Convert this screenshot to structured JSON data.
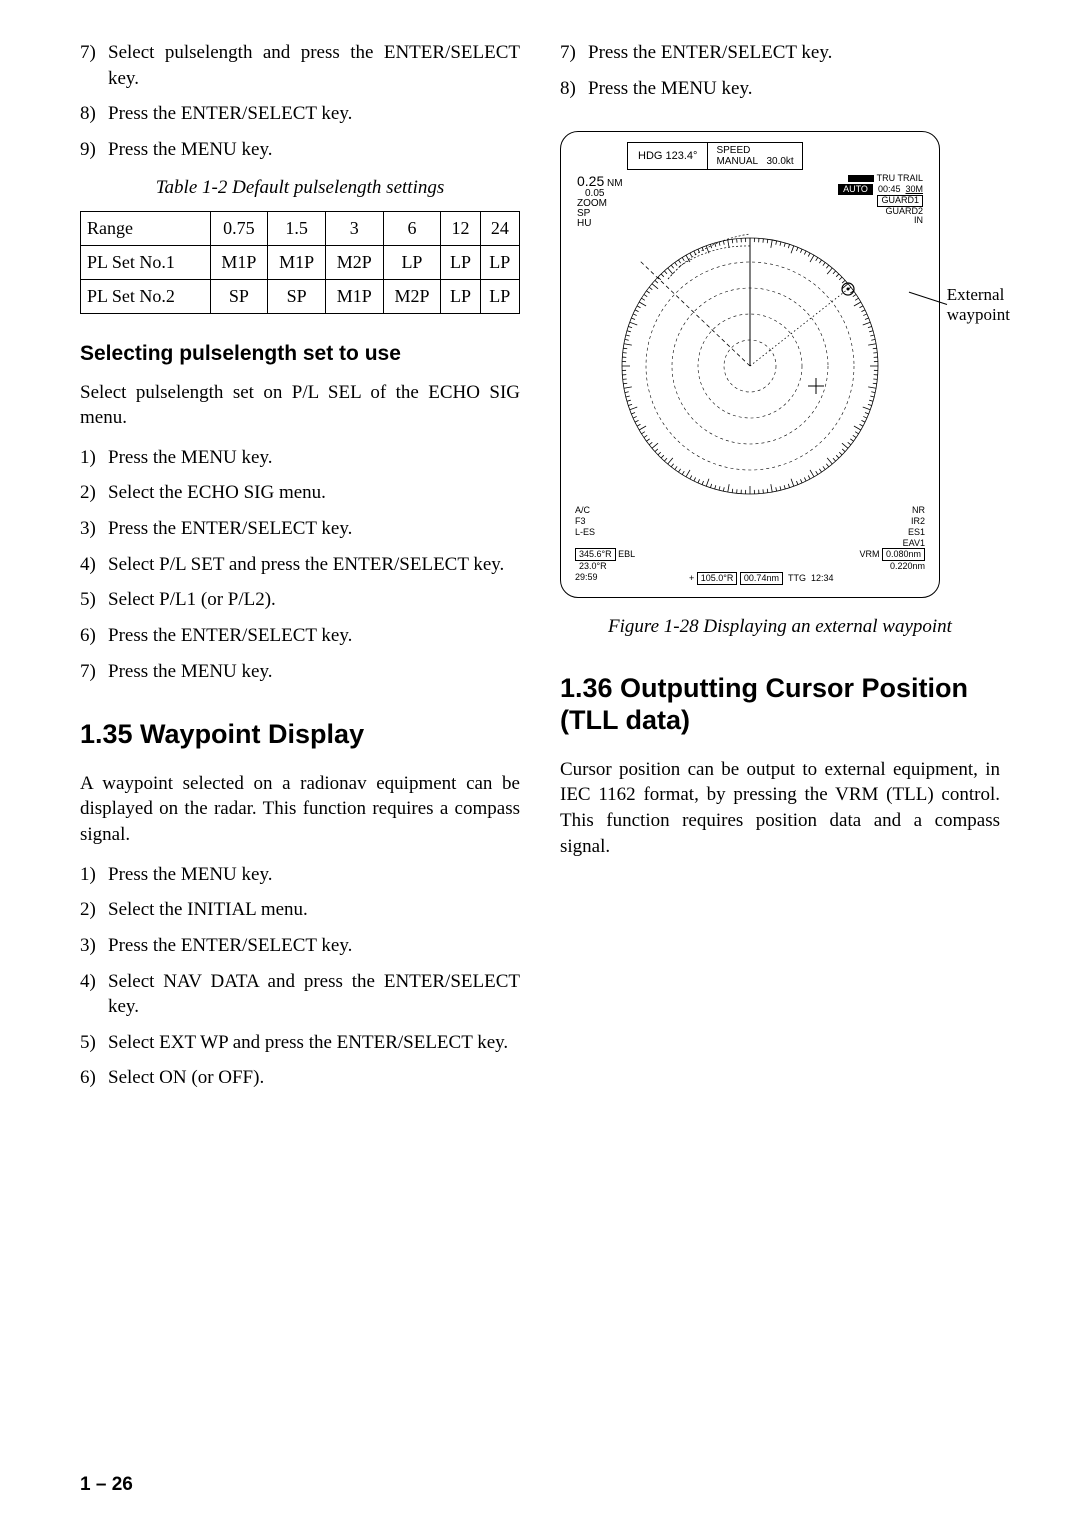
{
  "left": {
    "steps1": [
      {
        "n": "7)",
        "t": "Select pulselength and press the ENTER/SELECT key."
      },
      {
        "n": "8)",
        "t": "Press the ENTER/SELECT key."
      },
      {
        "n": "9)",
        "t": "Press the MENU key."
      }
    ],
    "table_caption": "Table 1-2 Default pulselength settings",
    "table": {
      "header": [
        "Range",
        "0.75",
        "1.5",
        "3",
        "6",
        "12",
        "24"
      ],
      "rows": [
        [
          "PL Set No.1",
          "M1P",
          "M1P",
          "M2P",
          "LP",
          "LP",
          "LP"
        ],
        [
          "PL Set No.2",
          "SP",
          "SP",
          "M1P",
          "M2P",
          "LP",
          "LP"
        ]
      ]
    },
    "subhead": "Selecting pulselength set to use",
    "para1": "Select pulselength set on P/L SEL of the ECHO SIG menu.",
    "steps2": [
      {
        "n": "1)",
        "t": "Press the MENU key."
      },
      {
        "n": "2)",
        "t": "Select the ECHO SIG menu."
      },
      {
        "n": "3)",
        "t": "Press the ENTER/SELECT key."
      },
      {
        "n": "4)",
        "t": "Select P/L SET and press the ENTER/SELECT key."
      },
      {
        "n": "5)",
        "t": "Select P/L1 (or P/L2)."
      },
      {
        "n": "6)",
        "t": "Press the ENTER/SELECT key."
      },
      {
        "n": "7)",
        "t": "Press the MENU key."
      }
    ],
    "section_head": "1.35 Waypoint Display",
    "para2": "A waypoint selected on a radionav equipment can be displayed on the radar. This function requires a compass signal.",
    "steps3": [
      {
        "n": "1)",
        "t": "Press the MENU key."
      },
      {
        "n": "2)",
        "t": "Select the INITIAL menu."
      },
      {
        "n": "3)",
        "t": "Press the ENTER/SELECT key."
      },
      {
        "n": "4)",
        "t": "Select NAV DATA and press the ENTER/SELECT key."
      },
      {
        "n": "5)",
        "t": "Select EXT WP and press the ENTER/SELECT key."
      },
      {
        "n": "6)",
        "t": "Select ON (or OFF)."
      }
    ]
  },
  "right": {
    "steps1": [
      {
        "n": "7)",
        "t": "Press the ENTER/SELECT key."
      },
      {
        "n": "8)",
        "t": "Press the MENU key."
      }
    ],
    "radar": {
      "hdg": "HDG 123.4°",
      "speed_lbl": "SPEED",
      "speed_mode": "MANUAL",
      "speed_val": "30.0kt",
      "range": "0.25",
      "range_unit": "NM",
      "range_step": "0.05",
      "zoom": "ZOOM",
      "sp": "SP",
      "hu": "HU",
      "auto": "AUTO",
      "trail_lbl": "TRU TRAIL",
      "trail_time": "00:45",
      "trail_dur": "30M",
      "guard1": "GUARD1",
      "guard2": "GUARD2",
      "in": "IN",
      "ac": "A/C",
      "f3": "F3",
      "les": "L-ES",
      "nr": "NR",
      "ir2": "IR2",
      "es1": "ES1",
      "eav1": "EAV1",
      "ebl_val": "345.6°R",
      "ebl_lbl": "EBL",
      "brg": "23.0°R",
      "time": "29:59",
      "plus_brg": "105.0°R",
      "plus_rng": "00.74nm",
      "ttg": "TTG",
      "ttg_val": "12:34",
      "vrm_lbl": "VRM",
      "vrm1": "0.080nm",
      "vrm2": "0.220nm"
    },
    "ext_label_1": "External",
    "ext_label_2": "waypoint",
    "fig_caption": "Figure 1-28 Displaying an external waypoint",
    "section_head": "1.36 Outputting Cursor Position (TLL data)",
    "para": "Cursor position can be output to external equipment, in IEC 1162 format, by pressing the VRM (TLL) control. This function requires position data and a compass signal."
  },
  "page_num": "1 – 26",
  "chart_data": {
    "type": "table",
    "title": "Default pulselength settings",
    "categories": [
      "0.75",
      "1.5",
      "3",
      "6",
      "12",
      "24"
    ],
    "series": [
      {
        "name": "PL Set No.1",
        "values": [
          "M1P",
          "M1P",
          "M2P",
          "LP",
          "LP",
          "LP"
        ]
      },
      {
        "name": "PL Set No.2",
        "values": [
          "SP",
          "SP",
          "M1P",
          "M2P",
          "LP",
          "LP"
        ]
      }
    ]
  }
}
